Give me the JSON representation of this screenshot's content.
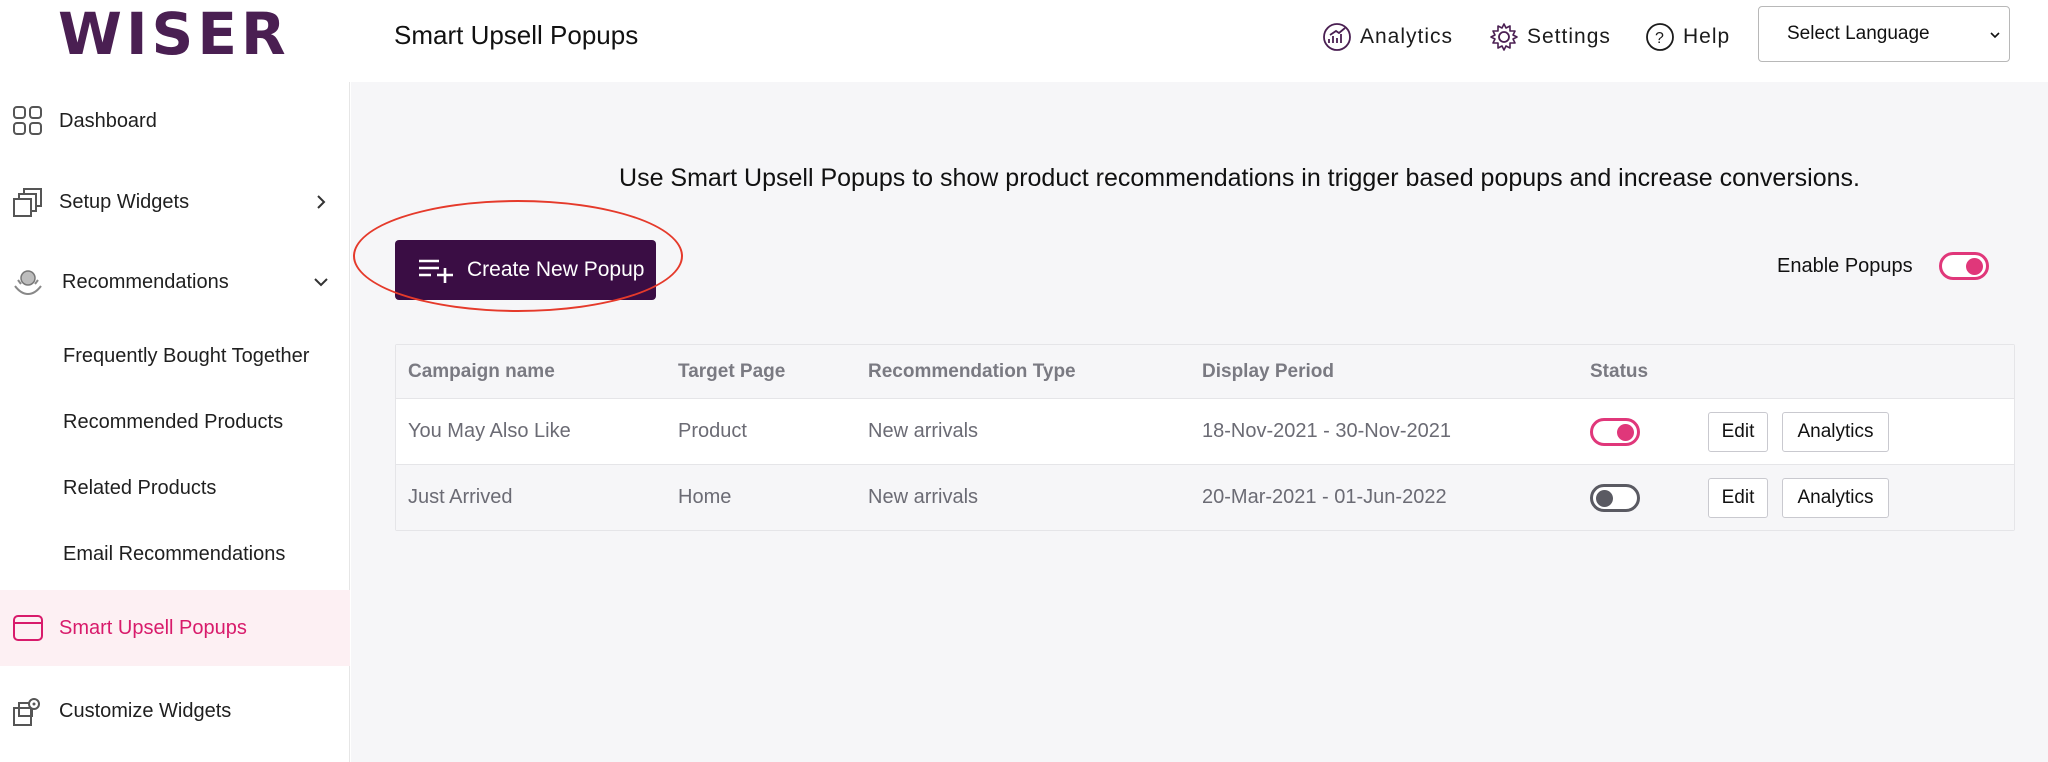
{
  "header": {
    "logo_text": "WISER",
    "page_title": "Smart Upsell Popups",
    "analytics_label": "Analytics",
    "settings_label": "Settings",
    "help_label": "Help",
    "language_select": "Select Language"
  },
  "sidebar": {
    "items": [
      {
        "label": "Dashboard",
        "icon": "grid-icon"
      },
      {
        "label": "Setup Widgets",
        "icon": "layers-icon"
      },
      {
        "label": "Recommendations",
        "icon": "recommendations-icon"
      },
      {
        "label": "Smart Upsell Popups",
        "icon": "window-icon"
      },
      {
        "label": "Customize Widgets",
        "icon": "customize-icon"
      }
    ],
    "sub_items": [
      "Frequently Bought Together",
      "Recommended Products",
      "Related Products",
      "Email Recommendations"
    ]
  },
  "main": {
    "intro": "Use Smart Upsell Popups to show product recommendations in trigger based popups and increase conversions.",
    "create_button": "Create New Popup",
    "enable_label": "Enable Popups",
    "enable_on": true,
    "table": {
      "headers": [
        "Campaign name",
        "Target Page",
        "Recommendation Type",
        "Display Period",
        "Status"
      ],
      "rows": [
        {
          "name": "You May Also Like",
          "target": "Product",
          "type": "New arrivals",
          "period": "18-Nov-2021 - 30-Nov-2021",
          "status_on": true,
          "edit": "Edit",
          "analytics": "Analytics"
        },
        {
          "name": "Just Arrived",
          "target": "Home",
          "type": "New arrivals",
          "period": "20-Mar-2021 - 01-Jun-2022",
          "status_on": false,
          "edit": "Edit",
          "analytics": "Analytics"
        }
      ]
    }
  },
  "colors": {
    "brand": "#4a1f52",
    "primary_button": "#3a0d44",
    "accent": "#e0377a",
    "active_text": "#d81b6b",
    "highlight_ring": "#e53a2b"
  }
}
